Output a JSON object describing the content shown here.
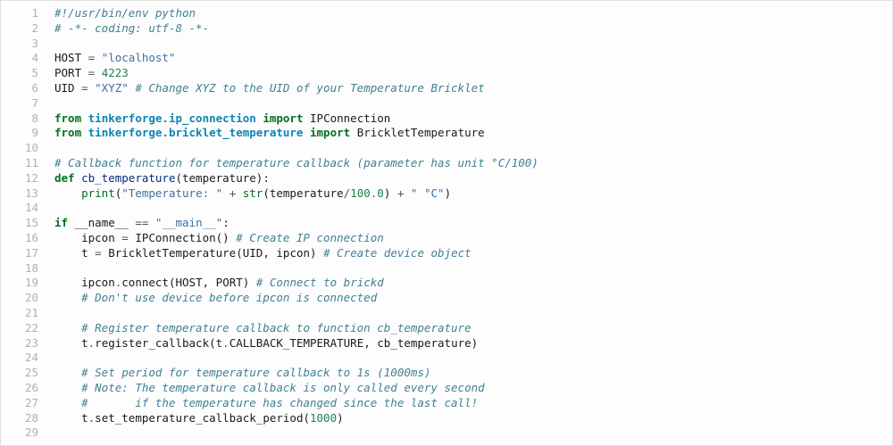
{
  "lines": [
    {
      "n": 1,
      "tokens": [
        [
          "c",
          "#!/usr/bin/env python"
        ]
      ]
    },
    {
      "n": 2,
      "tokens": [
        [
          "c",
          "# -*- coding: utf-8 -*-"
        ]
      ]
    },
    {
      "n": 3,
      "tokens": []
    },
    {
      "n": 4,
      "tokens": [
        [
          "n",
          "HOST"
        ],
        [
          "o",
          " = "
        ],
        [
          "s",
          "\"localhost\""
        ]
      ]
    },
    {
      "n": 5,
      "tokens": [
        [
          "n",
          "PORT"
        ],
        [
          "o",
          " = "
        ],
        [
          "m",
          "4223"
        ]
      ]
    },
    {
      "n": 6,
      "tokens": [
        [
          "n",
          "UID"
        ],
        [
          "o",
          " = "
        ],
        [
          "s",
          "\"XYZ\""
        ],
        [
          "p",
          " "
        ],
        [
          "c",
          "# Change XYZ to the UID of your Temperature Bricklet"
        ]
      ]
    },
    {
      "n": 7,
      "tokens": []
    },
    {
      "n": 8,
      "tokens": [
        [
          "kn",
          "from"
        ],
        [
          "p",
          " "
        ],
        [
          "nn",
          "tinkerforge.ip_connection"
        ],
        [
          "p",
          " "
        ],
        [
          "kn",
          "import"
        ],
        [
          "p",
          " "
        ],
        [
          "n",
          "IPConnection"
        ]
      ]
    },
    {
      "n": 9,
      "tokens": [
        [
          "kn",
          "from"
        ],
        [
          "p",
          " "
        ],
        [
          "nn",
          "tinkerforge.bricklet_temperature"
        ],
        [
          "p",
          " "
        ],
        [
          "kn",
          "import"
        ],
        [
          "p",
          " "
        ],
        [
          "n",
          "BrickletTemperature"
        ]
      ]
    },
    {
      "n": 10,
      "tokens": []
    },
    {
      "n": 11,
      "tokens": [
        [
          "c",
          "# Callback function for temperature callback (parameter has unit °C/100)"
        ]
      ]
    },
    {
      "n": 12,
      "tokens": [
        [
          "k",
          "def"
        ],
        [
          "p",
          " "
        ],
        [
          "nf",
          "cb_temperature"
        ],
        [
          "p",
          "("
        ],
        [
          "n",
          "temperature"
        ],
        [
          "p",
          "):"
        ]
      ]
    },
    {
      "n": 13,
      "tokens": [
        [
          "p",
          "    "
        ],
        [
          "bp",
          "print"
        ],
        [
          "p",
          "("
        ],
        [
          "s",
          "\"Temperature: \""
        ],
        [
          "o",
          " + "
        ],
        [
          "bp",
          "str"
        ],
        [
          "p",
          "("
        ],
        [
          "n",
          "temperature"
        ],
        [
          "o",
          "/"
        ],
        [
          "m",
          "100.0"
        ],
        [
          "p",
          ")"
        ],
        [
          "o",
          " + "
        ],
        [
          "s",
          "\" °C\""
        ],
        [
          "p",
          ")"
        ]
      ]
    },
    {
      "n": 14,
      "tokens": []
    },
    {
      "n": 15,
      "tokens": [
        [
          "k",
          "if"
        ],
        [
          "p",
          " "
        ],
        [
          "n",
          "__name__"
        ],
        [
          "o",
          " == "
        ],
        [
          "s",
          "\"__main__\""
        ],
        [
          "p",
          ":"
        ]
      ]
    },
    {
      "n": 16,
      "tokens": [
        [
          "p",
          "    "
        ],
        [
          "n",
          "ipcon"
        ],
        [
          "o",
          " = "
        ],
        [
          "n",
          "IPConnection"
        ],
        [
          "p",
          "() "
        ],
        [
          "c",
          "# Create IP connection"
        ]
      ]
    },
    {
      "n": 17,
      "tokens": [
        [
          "p",
          "    "
        ],
        [
          "n",
          "t"
        ],
        [
          "o",
          " = "
        ],
        [
          "n",
          "BrickletTemperature"
        ],
        [
          "p",
          "("
        ],
        [
          "n",
          "UID"
        ],
        [
          "p",
          ", "
        ],
        [
          "n",
          "ipcon"
        ],
        [
          "p",
          ") "
        ],
        [
          "c",
          "# Create device object"
        ]
      ]
    },
    {
      "n": 18,
      "tokens": []
    },
    {
      "n": 19,
      "tokens": [
        [
          "p",
          "    "
        ],
        [
          "n",
          "ipcon"
        ],
        [
          "o",
          "."
        ],
        [
          "n",
          "connect"
        ],
        [
          "p",
          "("
        ],
        [
          "n",
          "HOST"
        ],
        [
          "p",
          ", "
        ],
        [
          "n",
          "PORT"
        ],
        [
          "p",
          ") "
        ],
        [
          "c",
          "# Connect to brickd"
        ]
      ]
    },
    {
      "n": 20,
      "tokens": [
        [
          "p",
          "    "
        ],
        [
          "c",
          "# Don't use device before ipcon is connected"
        ]
      ]
    },
    {
      "n": 21,
      "tokens": []
    },
    {
      "n": 22,
      "tokens": [
        [
          "p",
          "    "
        ],
        [
          "c",
          "# Register temperature callback to function cb_temperature"
        ]
      ]
    },
    {
      "n": 23,
      "tokens": [
        [
          "p",
          "    "
        ],
        [
          "n",
          "t"
        ],
        [
          "o",
          "."
        ],
        [
          "n",
          "register_callback"
        ],
        [
          "p",
          "("
        ],
        [
          "n",
          "t"
        ],
        [
          "o",
          "."
        ],
        [
          "n",
          "CALLBACK_TEMPERATURE"
        ],
        [
          "p",
          ", "
        ],
        [
          "n",
          "cb_temperature"
        ],
        [
          "p",
          ")"
        ]
      ]
    },
    {
      "n": 24,
      "tokens": []
    },
    {
      "n": 25,
      "tokens": [
        [
          "p",
          "    "
        ],
        [
          "c",
          "# Set period for temperature callback to 1s (1000ms)"
        ]
      ]
    },
    {
      "n": 26,
      "tokens": [
        [
          "p",
          "    "
        ],
        [
          "c",
          "# Note: The temperature callback is only called every second"
        ]
      ]
    },
    {
      "n": 27,
      "tokens": [
        [
          "p",
          "    "
        ],
        [
          "c",
          "#       if the temperature has changed since the last call!"
        ]
      ]
    },
    {
      "n": 28,
      "tokens": [
        [
          "p",
          "    "
        ],
        [
          "n",
          "t"
        ],
        [
          "o",
          "."
        ],
        [
          "n",
          "set_temperature_callback_period"
        ],
        [
          "p",
          "("
        ],
        [
          "m",
          "1000"
        ],
        [
          "p",
          ")"
        ]
      ]
    },
    {
      "n": 29,
      "tokens": []
    }
  ]
}
